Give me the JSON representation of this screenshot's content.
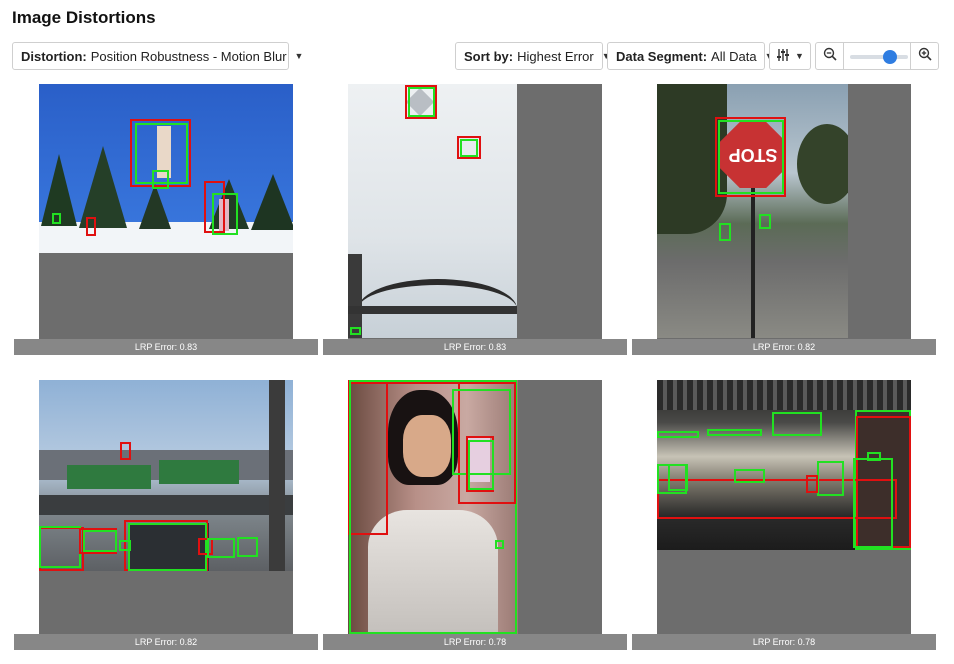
{
  "header": {
    "title": "Image Distortions"
  },
  "toolbar": {
    "distortion_label": "Distortion:",
    "distortion_value": "Position Robustness - Motion Blur",
    "sort_label": "Sort by:",
    "sort_value": "Highest Error",
    "segment_label": "Data Segment:",
    "segment_value": "All Data",
    "zoom_level": 0.75
  },
  "icons": {
    "caret": "chevron-down-icon",
    "filter": "sliders-icon",
    "zoom_out": "zoom-out-icon",
    "zoom_in": "zoom-in-icon"
  },
  "colors": {
    "ground_truth_box": "#22e022",
    "prediction_box": "#e01010",
    "card_background": "#6d6d6d",
    "slider_accent": "#2f7de1"
  },
  "cards": [
    {
      "caption": "LRP Error: 0.83"
    },
    {
      "caption": "LRP Error: 0.83"
    },
    {
      "caption": "LRP Error: 0.82"
    },
    {
      "caption": "LRP Error: 0.82"
    },
    {
      "caption": "LRP Error: 0.78"
    },
    {
      "caption": "LRP Error: 0.78"
    }
  ],
  "stop_sign": {
    "text": "STOP"
  }
}
